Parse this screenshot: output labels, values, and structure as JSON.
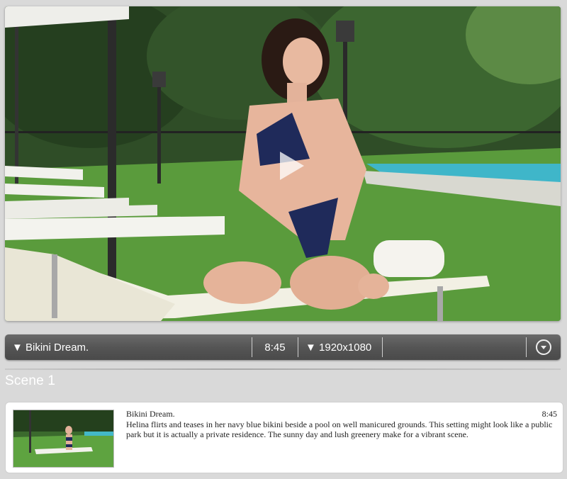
{
  "player": {
    "play_icon": "play-icon",
    "scene_image": "woman in navy bikini kneeling on sun lounger beside pool"
  },
  "info_bar": {
    "title": "▼ Bikini Dream.",
    "duration": "8:45",
    "resolution": "▼ 1920x1080",
    "download_icon": "download-icon"
  },
  "scene_heading": "Scene 1",
  "scene_card": {
    "title": "Bikini Dream.",
    "duration": "8:45",
    "description": "Helina flirts and teases in her navy blue bikini beside a pool on well manicured grounds. This setting might look like a public park but it is actually a private residence. The sunny day and lush greenery make for a vibrant scene."
  },
  "colors": {
    "bar_bg": "#555555",
    "page_bg": "#d9d9d9",
    "card_bg": "#ffffff"
  }
}
